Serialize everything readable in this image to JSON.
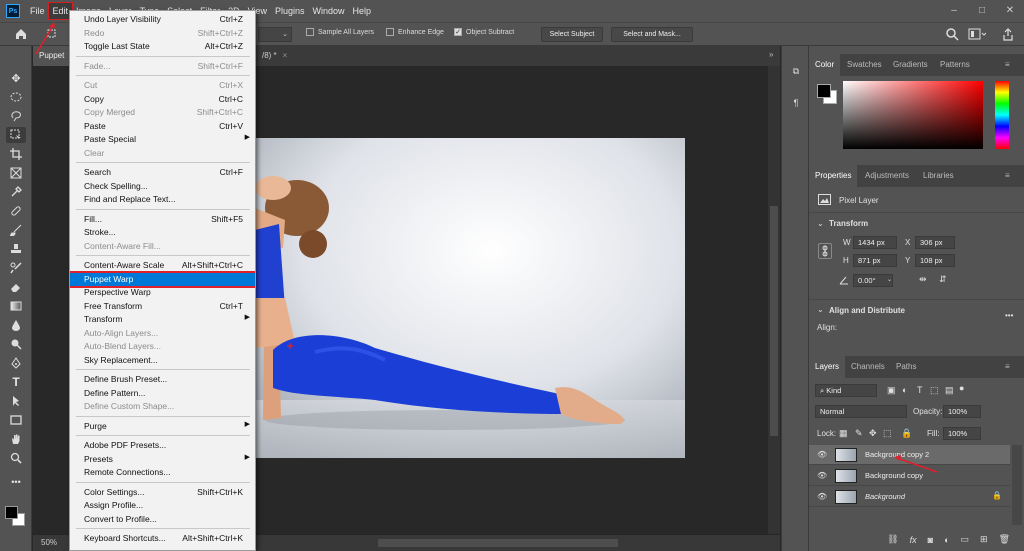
{
  "menubar": {
    "items": [
      "File",
      "Edit",
      "Image",
      "Layer",
      "Type",
      "Select",
      "Filter",
      "3D",
      "View",
      "Plugins",
      "Window",
      "Help"
    ],
    "active": "Edit"
  },
  "options_bar": {
    "sample_all_layers": "Sample All Layers",
    "enhance_edge": "Enhance Edge",
    "object_subtract": "Object Subtract",
    "select_subject": "Select Subject",
    "select_and_mask": "Select and Mask..."
  },
  "document": {
    "tab_left": "Puppet",
    "tab_right": "/8) *",
    "zoom": "50%"
  },
  "edit_menu": {
    "groups": [
      [
        {
          "label": "Undo Layer Visibility",
          "shortcut": "Ctrl+Z",
          "enabled": true
        },
        {
          "label": "Redo",
          "shortcut": "Shift+Ctrl+Z",
          "enabled": false
        },
        {
          "label": "Toggle Last State",
          "shortcut": "Alt+Ctrl+Z",
          "enabled": true
        }
      ],
      [
        {
          "label": "Fade...",
          "shortcut": "Shift+Ctrl+F",
          "enabled": false
        }
      ],
      [
        {
          "label": "Cut",
          "shortcut": "Ctrl+X",
          "enabled": false
        },
        {
          "label": "Copy",
          "shortcut": "Ctrl+C",
          "enabled": true
        },
        {
          "label": "Copy Merged",
          "shortcut": "Shift+Ctrl+C",
          "enabled": false
        },
        {
          "label": "Paste",
          "shortcut": "Ctrl+V",
          "enabled": true
        },
        {
          "label": "Paste Special",
          "shortcut": "",
          "enabled": true,
          "submenu": true
        },
        {
          "label": "Clear",
          "shortcut": "",
          "enabled": false
        }
      ],
      [
        {
          "label": "Search",
          "shortcut": "Ctrl+F",
          "enabled": true
        },
        {
          "label": "Check Spelling...",
          "shortcut": "",
          "enabled": true
        },
        {
          "label": "Find and Replace Text...",
          "shortcut": "",
          "enabled": true
        }
      ],
      [
        {
          "label": "Fill...",
          "shortcut": "Shift+F5",
          "enabled": true
        },
        {
          "label": "Stroke...",
          "shortcut": "",
          "enabled": true
        },
        {
          "label": "Content-Aware Fill...",
          "shortcut": "",
          "enabled": false
        }
      ],
      [
        {
          "label": "Content-Aware Scale",
          "shortcut": "Alt+Shift+Ctrl+C",
          "enabled": true
        },
        {
          "label": "Puppet Warp",
          "shortcut": "",
          "enabled": true,
          "highlight": true
        },
        {
          "label": "Perspective Warp",
          "shortcut": "",
          "enabled": true
        },
        {
          "label": "Free Transform",
          "shortcut": "Ctrl+T",
          "enabled": true
        },
        {
          "label": "Transform",
          "shortcut": "",
          "enabled": true,
          "submenu": true
        },
        {
          "label": "Auto-Align Layers...",
          "shortcut": "",
          "enabled": false
        },
        {
          "label": "Auto-Blend Layers...",
          "shortcut": "",
          "enabled": false
        },
        {
          "label": "Sky Replacement...",
          "shortcut": "",
          "enabled": true
        }
      ],
      [
        {
          "label": "Define Brush Preset...",
          "shortcut": "",
          "enabled": true
        },
        {
          "label": "Define Pattern...",
          "shortcut": "",
          "enabled": true
        },
        {
          "label": "Define Custom Shape...",
          "shortcut": "",
          "enabled": false
        }
      ],
      [
        {
          "label": "Purge",
          "shortcut": "",
          "enabled": true,
          "submenu": true
        }
      ],
      [
        {
          "label": "Adobe PDF Presets...",
          "shortcut": "",
          "enabled": true
        },
        {
          "label": "Presets",
          "shortcut": "",
          "enabled": true,
          "submenu": true
        },
        {
          "label": "Remote Connections...",
          "shortcut": "",
          "enabled": true
        }
      ],
      [
        {
          "label": "Color Settings...",
          "shortcut": "Shift+Ctrl+K",
          "enabled": true
        },
        {
          "label": "Assign Profile...",
          "shortcut": "",
          "enabled": true
        },
        {
          "label": "Convert to Profile...",
          "shortcut": "",
          "enabled": true
        }
      ],
      [
        {
          "label": "Keyboard Shortcuts...",
          "shortcut": "Alt+Shift+Ctrl+K",
          "enabled": true
        }
      ]
    ]
  },
  "color_panel": {
    "tabs": [
      "Color",
      "Swatches",
      "Gradients",
      "Patterns"
    ],
    "active_tab": "Color"
  },
  "properties_panel": {
    "tabs": [
      "Properties",
      "Adjustments",
      "Libraries"
    ],
    "active_tab": "Properties",
    "layer_type": "Pixel Layer",
    "transform_title": "Transform",
    "w_label": "W",
    "w_value": "1434 px",
    "x_label": "X",
    "x_value": "306 px",
    "h_label": "H",
    "h_value": "871 px",
    "y_label": "Y",
    "y_value": "108 px",
    "angle_value": "0.00°",
    "align_title": "Align and Distribute",
    "align_label": "Align:"
  },
  "layers_panel": {
    "tabs": [
      "Layers",
      "Channels",
      "Paths"
    ],
    "active_tab": "Layers",
    "kind_label": "Kind",
    "blend_mode": "Normal",
    "opacity_label": "Opacity:",
    "opacity_value": "100%",
    "lock_label": "Lock:",
    "fill_label": "Fill:",
    "fill_value": "100%",
    "layers": [
      {
        "name": "Background copy 2",
        "selected": true,
        "italic": false
      },
      {
        "name": "Background copy",
        "selected": false,
        "italic": false
      },
      {
        "name": "Background",
        "selected": false,
        "italic": true
      }
    ]
  },
  "colors": {
    "highlight": "#0078d7",
    "annotation_red": "#e0202a",
    "legging_blue": "#1b3fd6"
  }
}
